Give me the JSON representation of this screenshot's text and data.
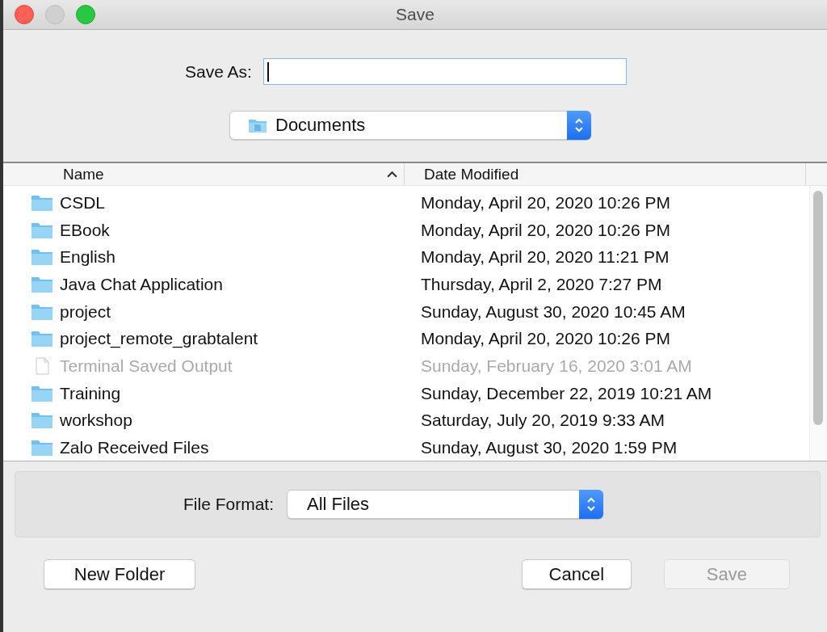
{
  "window": {
    "title": "Save"
  },
  "save_as": {
    "label": "Save As:"
  },
  "location": {
    "value": "Documents"
  },
  "table": {
    "columns": [
      {
        "label": "Name",
        "sorted": true
      },
      {
        "label": "Date Modified",
        "sorted": false
      }
    ],
    "rows": [
      {
        "kind": "folder",
        "name": "CSDL",
        "date": "Monday, April 20, 2020 10:26 PM",
        "disabled": false
      },
      {
        "kind": "folder",
        "name": "EBook",
        "date": "Monday, April 20, 2020 10:26 PM",
        "disabled": false
      },
      {
        "kind": "folder",
        "name": "English",
        "date": "Monday, April 20, 2020 11:21 PM",
        "disabled": false
      },
      {
        "kind": "folder",
        "name": "Java Chat Application",
        "date": "Thursday, April 2, 2020 7:27 PM",
        "disabled": false
      },
      {
        "kind": "folder",
        "name": "project",
        "date": "Sunday, August 30, 2020 10:45 AM",
        "disabled": false
      },
      {
        "kind": "folder",
        "name": "project_remote_grabtalent",
        "date": "Monday, April 20, 2020 10:26 PM",
        "disabled": false
      },
      {
        "kind": "file",
        "name": "Terminal Saved Output",
        "date": "Sunday, February 16, 2020 3:01 AM",
        "disabled": true
      },
      {
        "kind": "folder",
        "name": "Training",
        "date": "Sunday, December 22, 2019 10:21 AM",
        "disabled": false
      },
      {
        "kind": "folder",
        "name": "workshop",
        "date": "Saturday, July 20, 2019 9:33 AM",
        "disabled": false
      },
      {
        "kind": "folder",
        "name": "Zalo Received Files",
        "date": "Sunday, August 30, 2020 1:59 PM",
        "disabled": false
      }
    ]
  },
  "file_format": {
    "label": "File Format:",
    "value": "All Files"
  },
  "buttons": [
    {
      "kind": "new",
      "label": "New Folder",
      "disabled": false
    },
    {
      "kind": "cancel",
      "label": "Cancel",
      "disabled": false
    },
    {
      "kind": "save",
      "label": "Save",
      "disabled": true
    }
  ]
}
